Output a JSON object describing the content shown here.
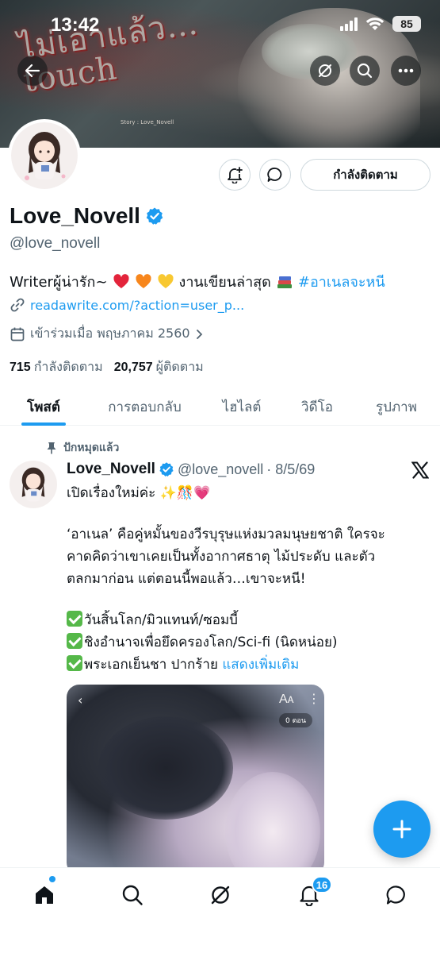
{
  "status_bar": {
    "time": "13:42",
    "battery": "85"
  },
  "banner": {
    "title_art": "ไม่เอาแล้ว… touch",
    "credit": "Story : Love_Novell"
  },
  "profile": {
    "follow_button": "กำลังติดตาม",
    "display_name": "Love_Novell",
    "handle": "@love_novell",
    "bio_prefix": "Writerผู้น่ารัก~",
    "bio_middle": "งานเขียนล่าสุด",
    "bio_hashtag": "#อาเนลจะหนี",
    "link": "readawrite.com/?action=user_p...",
    "joined": "เข้าร่วมเมื่อ พฤษภาคม 2560",
    "following_count": "715",
    "following_label": "กำลังติดตาม",
    "followers_count": "20,757",
    "followers_label": "ผู้ติดตาม",
    "verified_color": "#1d9bf0"
  },
  "tabs": [
    {
      "label": "โพสต์",
      "active": true
    },
    {
      "label": "การตอบกลับ",
      "active": false
    },
    {
      "label": "ไฮไลต์",
      "active": false
    },
    {
      "label": "วิดีโอ",
      "active": false
    },
    {
      "label": "รูปภาพ",
      "active": false
    }
  ],
  "tweet": {
    "pinned_label": "ปักหมุดแล้ว",
    "name": "Love_Novell",
    "handle": "@love_novell",
    "date": "· 8/5/69",
    "line1": "เปิดเรื่องใหม่ค่ะ ✨🎊💗",
    "para1": "‘อาเนล’ คือคู่หมั้นของวีรบุรุษแห่งมวลมนุษยชาติ ใครจะ",
    "para2": "คาดคิดว่าเขาเคยเป็นทั้งอากาศธาตุ ไม้ประดับ และตัว",
    "para3": "ตลกมาก่อน แต่ตอนนี้พอแล้ว…เขาจะหนี!",
    "item1": "วันสิ้นโลก/มิวแทนท์/ซอมบี้",
    "item2": "ชิงอำนาจเพื่อยึดครองโลก/Sci-fi (นิดหน่อย)",
    "item3": "พระเอกเย็นชา ปากร้าย",
    "show_more": "แสดงเพิ่มเติม",
    "image_ui_aa": "Aᴀ",
    "image_ui_pill": "0 ตอน"
  },
  "nav": {
    "notifications_badge": "16",
    "icons": [
      "home-icon",
      "search-icon",
      "grok-icon",
      "bell-icon",
      "messages-icon"
    ]
  },
  "colors": {
    "accent": "#1d9bf0",
    "text": "#0f1419",
    "muted": "#536471"
  }
}
